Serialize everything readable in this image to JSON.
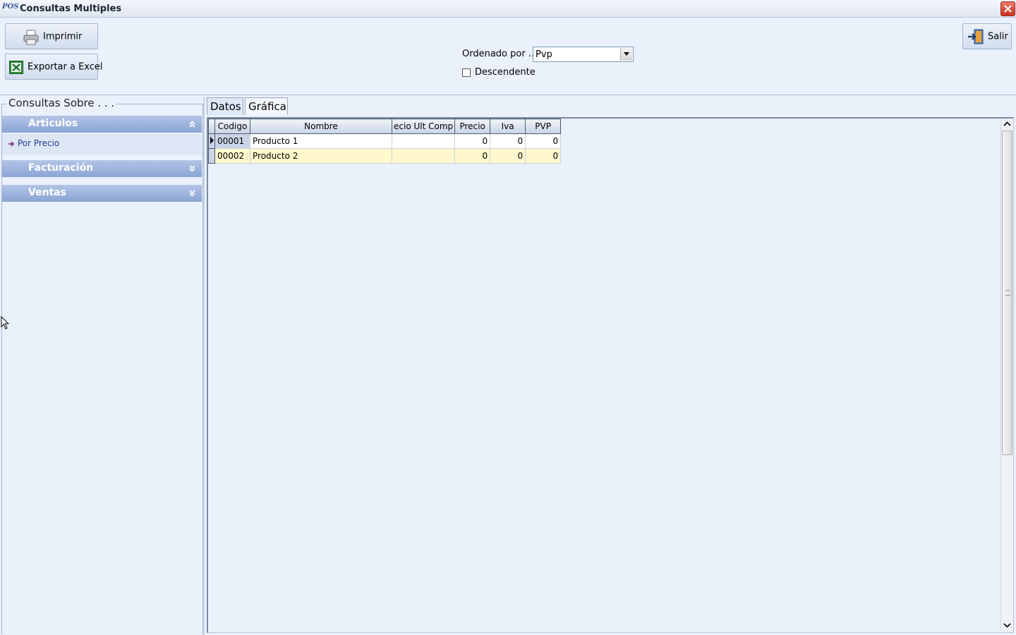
{
  "window": {
    "title": "Consultas Multiples",
    "logo": "POS"
  },
  "toolbar": {
    "print_label": "Imprimir",
    "excel_label": "Exportar a Excel",
    "exit_label": "Salir",
    "order_label": "Ordenado por ...",
    "order_value": "Pvp",
    "descending_label": "Descendente",
    "descending_checked": false
  },
  "sidebar": {
    "title": "Consultas Sobre . . .",
    "groups": [
      {
        "label": "Articulos",
        "expanded": true,
        "items": [
          {
            "label": "Por Precio"
          }
        ]
      },
      {
        "label": "Facturación",
        "expanded": false
      },
      {
        "label": "Ventas",
        "expanded": false
      }
    ]
  },
  "tabs": [
    {
      "label": "Datos",
      "active": true
    },
    {
      "label": "Gráfica",
      "active": false
    }
  ],
  "grid": {
    "columns": [
      "Codigo",
      "Nombre",
      "ecio Ult Comp",
      "Precio",
      "Iva",
      "PVP"
    ],
    "rows": [
      [
        "00001",
        "Producto 1",
        "",
        "0",
        "0",
        "0"
      ],
      [
        "00002",
        "Producto 2",
        "",
        "0",
        "0",
        "0"
      ]
    ]
  },
  "icons": {
    "print": "printer-icon",
    "excel": "excel-icon",
    "exit": "exit-door-icon",
    "close": "close-icon"
  }
}
